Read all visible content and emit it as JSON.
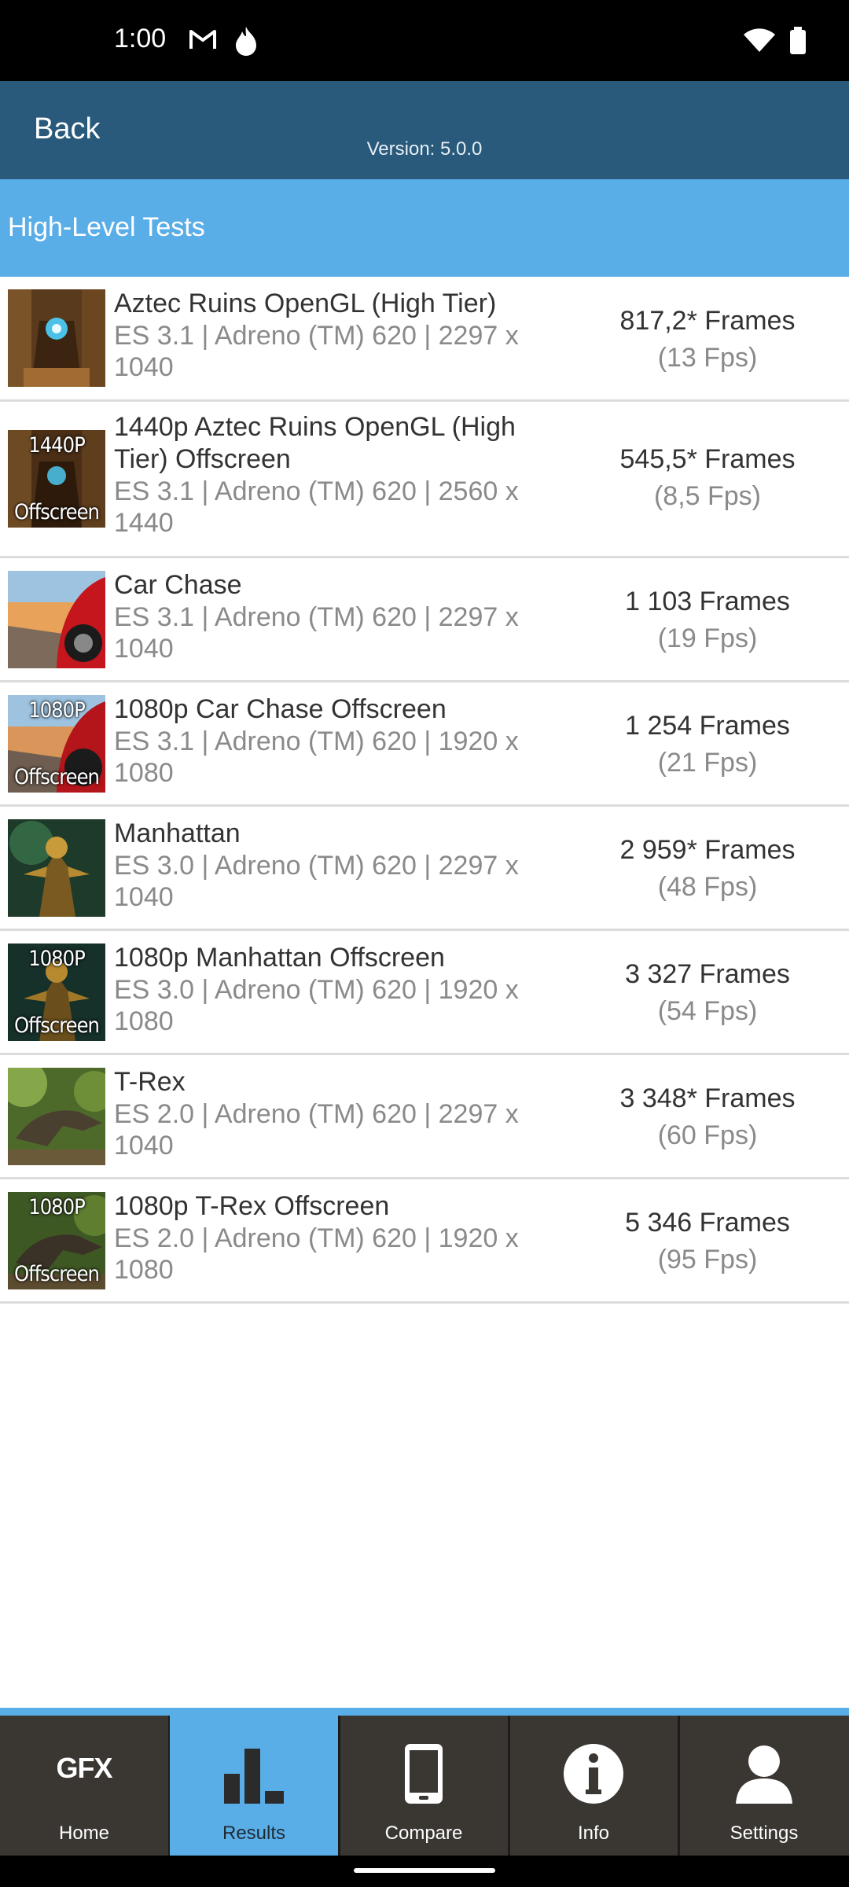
{
  "status_bar": {
    "time": "1:00",
    "icons": [
      "gmail-icon",
      "flame-icon",
      "wifi-icon",
      "battery-icon"
    ]
  },
  "app_bar": {
    "back_label": "Back",
    "version": "Version: 5.0.0"
  },
  "section": {
    "title": "High-Level Tests"
  },
  "tests": [
    {
      "name": "Aztec Ruins OpenGL (High Tier)",
      "detail": "ES 3.1 | Adreno (TM) 620 | 2297 x 1040",
      "frames": "817,2* Frames",
      "fps": "(13 Fps)",
      "thumb_top": "",
      "thumb_bottom": ""
    },
    {
      "name": "1440p Aztec Ruins OpenGL (High Tier) Offscreen",
      "detail": "ES 3.1 | Adreno (TM) 620 | 2560 x 1440",
      "frames": "545,5* Frames",
      "fps": "(8,5 Fps)",
      "thumb_top": "1440P",
      "thumb_bottom": "Offscreen"
    },
    {
      "name": "Car Chase",
      "detail": "ES 3.1 | Adreno (TM) 620 | 2297 x 1040",
      "frames": "1 103 Frames",
      "fps": "(19 Fps)",
      "thumb_top": "",
      "thumb_bottom": ""
    },
    {
      "name": "1080p Car Chase Offscreen",
      "detail": "ES 3.1 | Adreno (TM) 620 | 1920 x 1080",
      "frames": "1 254 Frames",
      "fps": "(21 Fps)",
      "thumb_top": "1080P",
      "thumb_bottom": "Offscreen"
    },
    {
      "name": "Manhattan",
      "detail": "ES 3.0 | Adreno (TM) 620 | 2297 x 1040",
      "frames": "2 959* Frames",
      "fps": "(48 Fps)",
      "thumb_top": "",
      "thumb_bottom": ""
    },
    {
      "name": "1080p Manhattan Offscreen",
      "detail": "ES 3.0 | Adreno (TM) 620 | 1920 x 1080",
      "frames": "3 327 Frames",
      "fps": "(54 Fps)",
      "thumb_top": "1080P",
      "thumb_bottom": "Offscreen"
    },
    {
      "name": "T-Rex",
      "detail": "ES 2.0 | Adreno (TM) 620 | 2297 x 1040",
      "frames": "3 348* Frames",
      "fps": "(60 Fps)",
      "thumb_top": "",
      "thumb_bottom": ""
    },
    {
      "name": "1080p T-Rex Offscreen",
      "detail": "ES 2.0 | Adreno (TM) 620 | 1920 x 1080",
      "frames": "5 346 Frames",
      "fps": "(95 Fps)",
      "thumb_top": "1080P",
      "thumb_bottom": "Offscreen"
    }
  ],
  "tabs": [
    {
      "label": "Home",
      "icon": "gfx-logo-icon",
      "logo_text": "GFX",
      "active": false
    },
    {
      "label": "Results",
      "icon": "bar-chart-icon",
      "active": true
    },
    {
      "label": "Compare",
      "icon": "phone-icon",
      "active": false
    },
    {
      "label": "Info",
      "icon": "info-icon",
      "active": false
    },
    {
      "label": "Settings",
      "icon": "user-icon",
      "active": false
    }
  ],
  "colors": {
    "app_bar": "#295a7b",
    "accent": "#5aaee8",
    "tab_bar": "#3a3632"
  }
}
